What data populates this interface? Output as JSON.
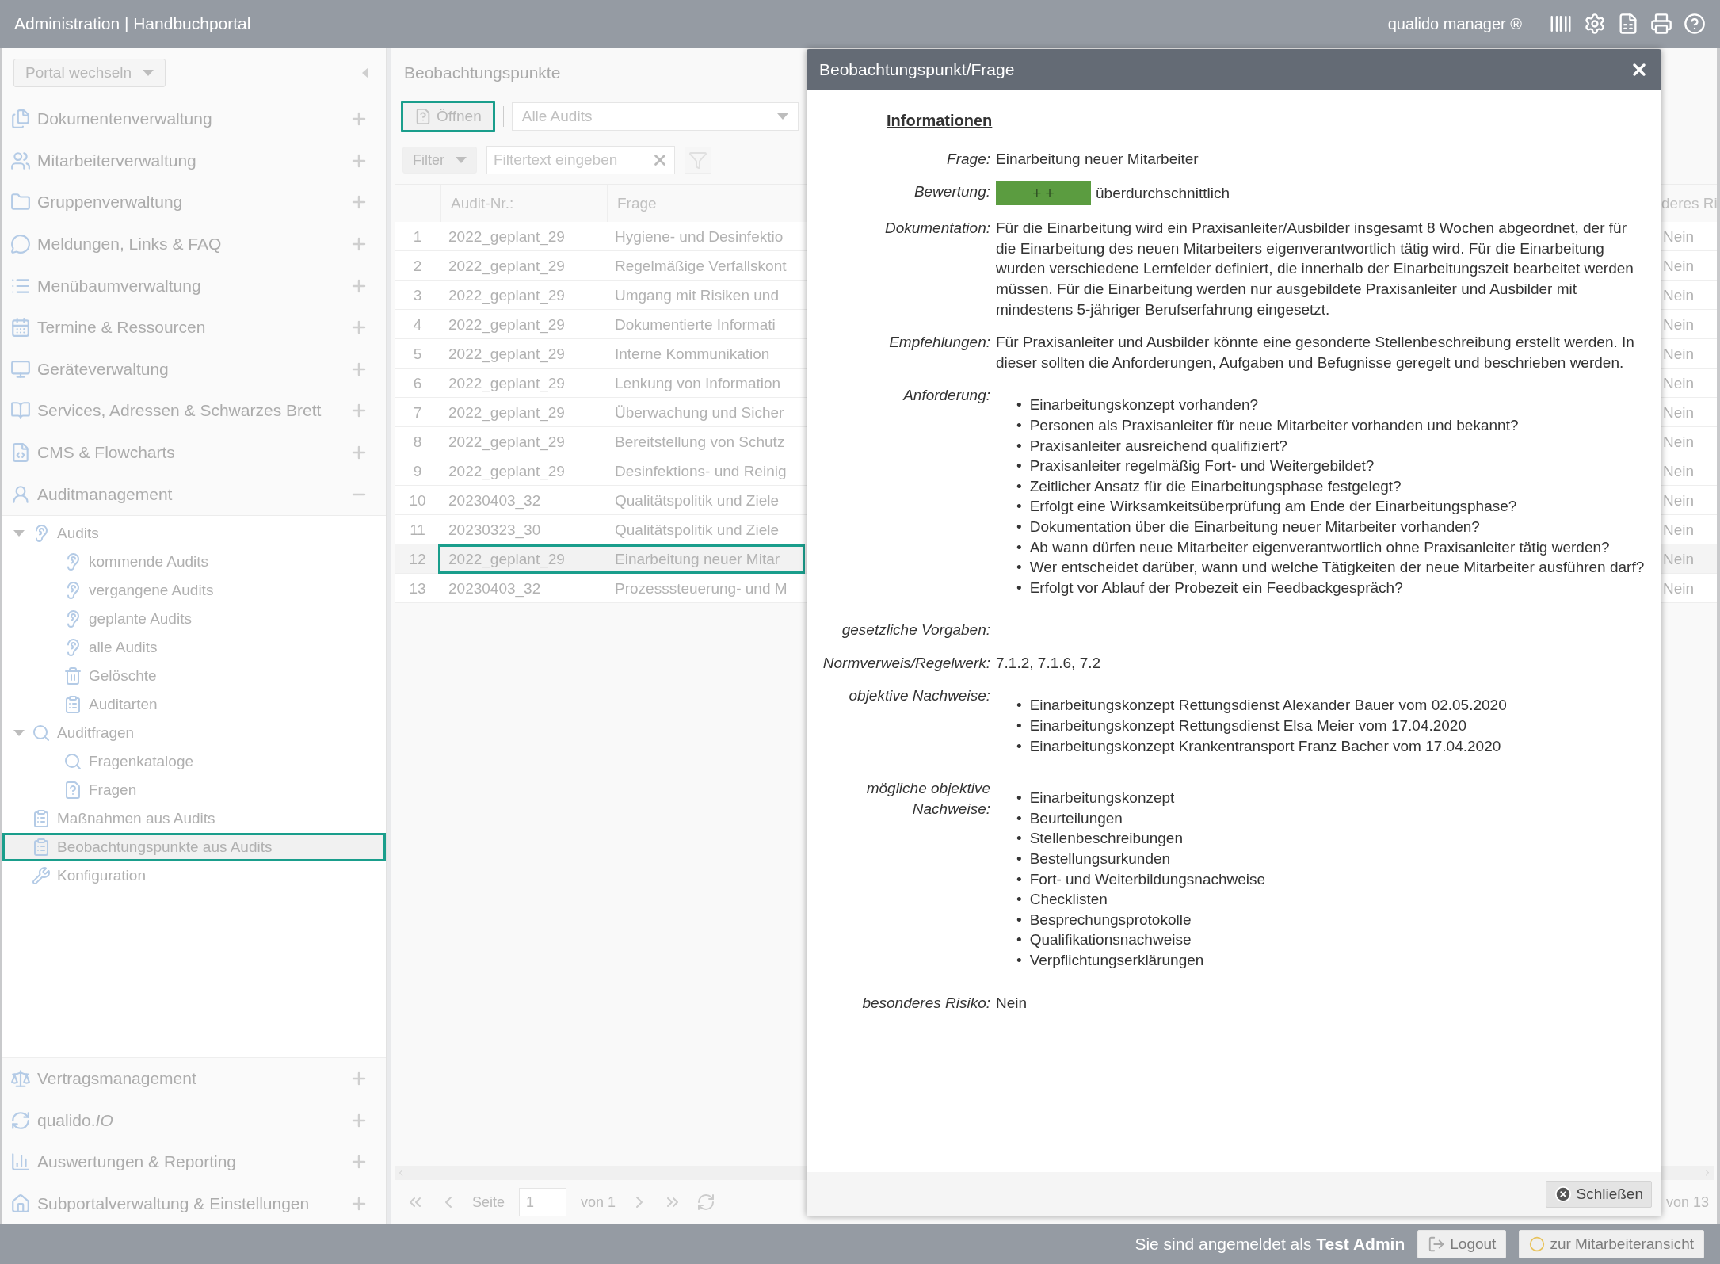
{
  "topbar": {
    "title": "Administration | Handbuchportal",
    "product": "qualido manager ®"
  },
  "sidebar": {
    "portal_select": "Portal wechseln",
    "groups": [
      {
        "label": "Dokumentenverwaltung",
        "expanded": false
      },
      {
        "label": "Mitarbeiterverwaltung",
        "expanded": false
      },
      {
        "label": "Gruppenverwaltung",
        "expanded": false
      },
      {
        "label": "Meldungen, Links & FAQ",
        "expanded": false
      },
      {
        "label": "Menübaumverwaltung",
        "expanded": false
      },
      {
        "label": "Termine & Ressourcen",
        "expanded": false
      },
      {
        "label": "Geräteverwaltung",
        "expanded": false
      },
      {
        "label": "Services, Adressen & Schwarzes Brett",
        "expanded": false
      },
      {
        "label": "CMS & Flowcharts",
        "expanded": false
      },
      {
        "label": "Auditmanagement",
        "expanded": true
      }
    ],
    "tree": [
      {
        "label": "Audits",
        "selected": false,
        "expanded": true,
        "children": [
          {
            "label": "kommende Audits",
            "selected": false
          },
          {
            "label": "vergangene Audits",
            "selected": false
          },
          {
            "label": "geplante Audits",
            "selected": false
          },
          {
            "label": "alle Audits",
            "selected": false
          },
          {
            "label": "Gelöschte",
            "selected": false
          },
          {
            "label": "Auditarten",
            "selected": false
          }
        ]
      },
      {
        "label": "Auditfragen",
        "selected": false,
        "expanded": true,
        "children": [
          {
            "label": "Fragenkataloge",
            "selected": false
          },
          {
            "label": "Fragen",
            "selected": false
          }
        ]
      },
      {
        "label": "Maßnahmen aus Audits",
        "selected": false
      },
      {
        "label": "Beobachtungspunkte aus Audits",
        "selected": true
      },
      {
        "label": "Konfiguration",
        "selected": false
      }
    ],
    "bottom_groups": [
      {
        "label": "Vertragsmanagement",
        "expanded": false
      },
      {
        "label": "qualido.*IO*",
        "expanded": false
      },
      {
        "label": "Auswertungen & Reporting",
        "expanded": false
      },
      {
        "label": "Subportalverwaltung & Einstellungen",
        "expanded": false
      }
    ]
  },
  "panel": {
    "title": "Beobachtungspunkte",
    "open_button": {
      "label": "Öffnen",
      "focused": true
    },
    "audit_select": "Alle Audits",
    "filter_button": "Filter",
    "filter_field": {
      "placeholder": "Filtertext eingeben"
    },
    "table": {
      "columns": [
        "Audit-Nr.:",
        "Frage",
        "deres Ri"
      ],
      "rows": [
        {
          "number": "1",
          "audit": "2022_geplant_29",
          "frage": "Hygiene- und Desinfektio",
          "risk": "Nein",
          "selected": false
        },
        {
          "number": "2",
          "audit": "2022_geplant_29",
          "frage": "Regelmäßige Verfallskont",
          "risk": "Nein",
          "selected": false
        },
        {
          "number": "3",
          "audit": "2022_geplant_29",
          "frage": "Umgang mit Risiken und",
          "risk": "Nein",
          "selected": false
        },
        {
          "number": "4",
          "audit": "2022_geplant_29",
          "frage": "Dokumentierte Informati",
          "risk": "Nein",
          "selected": false
        },
        {
          "number": "5",
          "audit": "2022_geplant_29",
          "frage": "Interne Kommunikation",
          "risk": "Nein",
          "selected": false
        },
        {
          "number": "6",
          "audit": "2022_geplant_29",
          "frage": "Lenkung von Information",
          "risk": "Nein",
          "selected": false
        },
        {
          "number": "7",
          "audit": "2022_geplant_29",
          "frage": "Überwachung und Sicher",
          "risk": "Nein",
          "selected": false
        },
        {
          "number": "8",
          "audit": "2022_geplant_29",
          "frage": "Bereitstellung von Schutz",
          "risk": "Nein",
          "selected": false
        },
        {
          "number": "9",
          "audit": "2022_geplant_29",
          "frage": "Desinfektions- und Reinig",
          "risk": "Nein",
          "selected": false
        },
        {
          "number": "10",
          "audit": "20230403_32",
          "frage": "Qualitätspolitik und Ziele",
          "risk": "Nein",
          "selected": false
        },
        {
          "number": "11",
          "audit": "20230323_30",
          "frage": "Qualitätspolitik und Ziele",
          "risk": "Nein",
          "selected": false
        },
        {
          "number": "12",
          "audit": "2022_geplant_29",
          "frage": "Einarbeitung neuer Mitar",
          "risk": "Nein",
          "selected": true
        },
        {
          "number": "13",
          "audit": "20230403_32",
          "frage": "Prozesssteuerung- und M",
          "risk": "Nein",
          "selected": false
        }
      ]
    },
    "pager": {
      "page_label": "Seite",
      "page": "1",
      "of_pages": "von 1",
      "total": "von 13"
    }
  },
  "dialog": {
    "title": "Beobachtungspunkt/Frage",
    "section": "Informationen",
    "fields": [
      {
        "kind": "text",
        "label": "Frage:",
        "value": "Einarbeitung neuer Mitarbeiter"
      },
      {
        "kind": "rating",
        "label": "Bewertung:",
        "badge": "+ +",
        "value": "überdurchschnittlich"
      },
      {
        "kind": "text",
        "label": "Dokumentation:",
        "value": "Für die Einarbeitung wird ein Praxisanleiter/Ausbilder insgesamt 8 Wochen abgeordnet, der für die Einarbeitung des neuen Mitarbeiters eigenverantwortlich tätig wird. Für die Einarbeitung wurden verschiedene Lernfelder definiert, die innerhalb der Einarbeitungszeit bearbeitet werden müssen. Für die Einarbeitung werden nur ausgebildete Praxisanleiter und Ausbilder mit mindestens 5-jähriger Berufserfahrung eingesetzt."
      },
      {
        "kind": "text",
        "label": "Empfehlungen:",
        "value": "Für Praxisanleiter und Ausbilder könnte eine gesonderte Stellenbeschreibung erstellt werden. In dieser sollten die Anforderungen, Aufgaben und Befugnisse geregelt und beschrieben werden."
      },
      {
        "kind": "list",
        "label": "Anforderung:",
        "marker": "•",
        "items": [
          "Einarbeitungskonzept vorhanden?",
          "Personen als Praxisanleiter für neue Mitarbeiter vorhanden und bekannt?",
          "Praxisanleiter ausreichend qualifiziert?",
          "Praxisanleiter regelmäßig Fort- und Weitergebildet?",
          "Zeitlicher Ansatz für die Einarbeitungsphase festgelegt?",
          "Erfolgt eine Wirksamkeitsüberprüfung am Ende der Einarbeitungsphase?",
          "Dokumentation über die Einarbeitung neuer Mitarbeiter vorhanden?",
          "Ab wann dürfen neue Mitarbeiter eigenverantwortlich ohne Praxisanleiter tätig werden?",
          "Wer entscheidet darüber, wann und welche Tätigkeiten der neue Mitarbeiter ausführen darf?",
          "Erfolgt vor Ablauf der Probezeit ein Feedbackgespräch?"
        ]
      },
      {
        "kind": "text",
        "label": "gesetzliche Vorgaben:"
      },
      {
        "kind": "text",
        "label": "Normverweis/Regelwerk:",
        "value": "7.1.2, 7.1.6, 7.2"
      },
      {
        "kind": "list",
        "label": "objektive Nachweise:",
        "marker": "•",
        "items": [
          "Einarbeitungskonzept Rettungsdienst Alexander Bauer vom 02.05.2020",
          "Einarbeitungskonzept Rettungsdienst Elsa Meier vom 17.04.2020",
          "Einarbeitungskonzept Krankentransport Franz Bacher vom 17.04.2020"
        ]
      },
      {
        "kind": "list",
        "label": "mögliche objektive Nachweise:",
        "marker": "•",
        "items": [
          "Einarbeitungskonzept",
          "Beurteilungen",
          "Stellenbeschreibungen",
          "Bestellungsurkunden",
          "Fort- und Weiterbildungsnachweise",
          "Checklisten",
          "Besprechungsprotokolle",
          "Qualifikationsnachweise",
          "Verpflichtungserklärungen"
        ]
      },
      {
        "kind": "text",
        "label": "besonderes Risiko:",
        "value": "Nein"
      }
    ],
    "close_button": "Schließen"
  },
  "footer": {
    "login": "Sie sind angemeldet als **Test Admin**",
    "logout": "Logout",
    "switch_view": "zur Mitarbeiteransicht"
  }
}
